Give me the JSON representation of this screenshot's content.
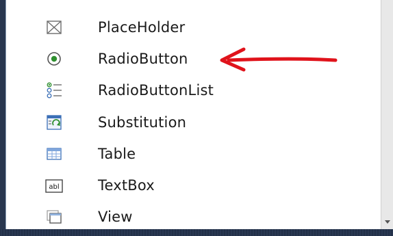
{
  "toolbox": {
    "items": [
      {
        "label": "PlaceHolder",
        "icon": "placeholder-icon"
      },
      {
        "label": "RadioButton",
        "icon": "radio-button-icon"
      },
      {
        "label": "RadioButtonList",
        "icon": "radio-button-list-icon"
      },
      {
        "label": "Substitution",
        "icon": "substitution-icon"
      },
      {
        "label": "Table",
        "icon": "table-icon"
      },
      {
        "label": "TextBox",
        "icon": "textbox-icon"
      },
      {
        "label": "View",
        "icon": "view-icon"
      }
    ],
    "textbox_icon_text": "abl"
  },
  "annotation": {
    "arrow_color": "#e0131b",
    "points_to": "RadioButton"
  },
  "colors": {
    "frame_dark": "#29374f",
    "accent_green": "#2f8f2f",
    "icon_blue": "#3b6fb6"
  }
}
